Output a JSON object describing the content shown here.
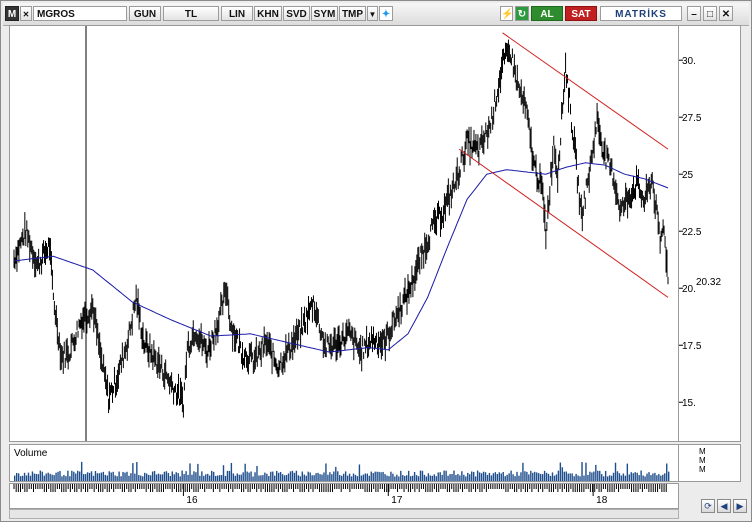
{
  "toolbar": {
    "menu_label": "M",
    "symbol_value": "MGROS",
    "period": "GUN",
    "currency": "TL",
    "scale": "LIN",
    "khn": "KHN",
    "svd": "SVD",
    "sym": "SYM",
    "tmp": "TMP",
    "buy_label": "AL",
    "sell_label": "SAT",
    "brand": "MATRİKS"
  },
  "chart_data": {
    "type": "line",
    "symbol": "MGROS",
    "ylim": [
      13.3,
      31.5
    ],
    "yticks": [
      15,
      17.5,
      20,
      22.5,
      25,
      27.5,
      30
    ],
    "ytick_labels": [
      "15.",
      "17.5",
      "20.",
      "22.5",
      "25",
      "27.5",
      "30."
    ],
    "last_price": 20.32,
    "last_price_label": "20.32",
    "x_tick_labels": [
      "16",
      "17",
      "18"
    ],
    "volume_label": "Volume",
    "volume_axis_label": "M",
    "price_series_anchors": [
      [
        0,
        21.3
      ],
      [
        3,
        22.5
      ],
      [
        6,
        21.0
      ],
      [
        9,
        21.9
      ],
      [
        10,
        19.6
      ],
      [
        12,
        17.0
      ],
      [
        14,
        17.2
      ],
      [
        17,
        18.6
      ],
      [
        20,
        19.2
      ],
      [
        22,
        17.0
      ],
      [
        24,
        15.2
      ],
      [
        26,
        16.0
      ],
      [
        29,
        17.8
      ],
      [
        31,
        19.6
      ],
      [
        33,
        17.6
      ],
      [
        37,
        16.6
      ],
      [
        40,
        15.8
      ],
      [
        43,
        15.0
      ],
      [
        44,
        17.4
      ],
      [
        46,
        18.2
      ],
      [
        49,
        17.2
      ],
      [
        52,
        18.6
      ],
      [
        54,
        20.0
      ],
      [
        55,
        18.4
      ],
      [
        58,
        17.2
      ],
      [
        61,
        16.8
      ],
      [
        64,
        17.6
      ],
      [
        67,
        16.6
      ],
      [
        70,
        17.4
      ],
      [
        73,
        18.2
      ],
      [
        76,
        19.4
      ],
      [
        79,
        17.4
      ],
      [
        82,
        17.6
      ],
      [
        85,
        18.0
      ],
      [
        88,
        17.2
      ],
      [
        91,
        17.8
      ],
      [
        94,
        17.6
      ],
      [
        97,
        18.8
      ],
      [
        100,
        19.8
      ],
      [
        103,
        21.2
      ],
      [
        106,
        22.6
      ],
      [
        109,
        23.4
      ],
      [
        112,
        24.6
      ],
      [
        115,
        26.4
      ],
      [
        118,
        26.0
      ],
      [
        121,
        27.2
      ],
      [
        124,
        29.8
      ],
      [
        126,
        30.4
      ],
      [
        128,
        28.8
      ],
      [
        130,
        27.8
      ],
      [
        132,
        25.4
      ],
      [
        134,
        24.4
      ],
      [
        135,
        22.4
      ],
      [
        137,
        26.4
      ],
      [
        138,
        25.0
      ],
      [
        140,
        29.8
      ],
      [
        142,
        26.6
      ],
      [
        144,
        23.2
      ],
      [
        146,
        25.0
      ],
      [
        148,
        27.4
      ],
      [
        150,
        25.8
      ],
      [
        152,
        25.0
      ],
      [
        154,
        23.4
      ],
      [
        156,
        24.0
      ],
      [
        158,
        24.6
      ],
      [
        160,
        23.8
      ],
      [
        162,
        24.8
      ],
      [
        164,
        22.0
      ],
      [
        165,
        22.8
      ],
      [
        166,
        20.3
      ]
    ],
    "moving_average_anchors": [
      [
        0,
        21.2
      ],
      [
        10,
        21.4
      ],
      [
        20,
        20.8
      ],
      [
        30,
        19.4
      ],
      [
        40,
        18.6
      ],
      [
        50,
        17.9
      ],
      [
        60,
        18.0
      ],
      [
        70,
        17.6
      ],
      [
        80,
        17.2
      ],
      [
        90,
        17.4
      ],
      [
        95,
        17.3
      ],
      [
        100,
        18.0
      ],
      [
        105,
        19.6
      ],
      [
        110,
        21.8
      ],
      [
        115,
        23.9
      ],
      [
        120,
        25.0
      ],
      [
        125,
        25.2
      ],
      [
        130,
        25.1
      ],
      [
        135,
        25.0
      ],
      [
        140,
        25.3
      ],
      [
        145,
        25.5
      ],
      [
        150,
        25.4
      ],
      [
        155,
        25.0
      ],
      [
        160,
        24.8
      ],
      [
        166,
        24.4
      ]
    ],
    "channel_upper": [
      [
        124,
        31.2
      ],
      [
        166,
        26.1
      ]
    ],
    "channel_lower": [
      [
        113,
        26.1
      ],
      [
        166,
        19.6
      ]
    ]
  }
}
